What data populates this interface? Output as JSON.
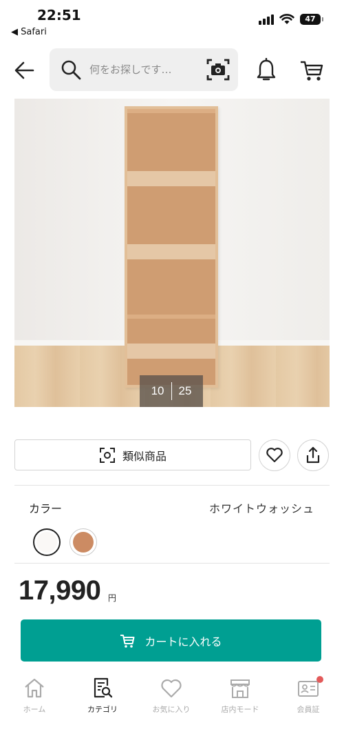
{
  "status_bar": {
    "time": "22:51",
    "back_app": "◀ Safari",
    "battery": "47"
  },
  "header": {
    "search_placeholder": "何をお探しです…"
  },
  "gallery": {
    "current": "10",
    "total": "25"
  },
  "actions": {
    "similar_label": "類似商品"
  },
  "color": {
    "label": "カラー",
    "selected": "ホワイトウォッシュ",
    "options": [
      {
        "name": "white-wash",
        "hex": "#faf8f6"
      },
      {
        "name": "brown",
        "hex": "#cc8b63"
      }
    ]
  },
  "price": {
    "amount": "17,990",
    "currency": "円"
  },
  "cart_button": {
    "label": "カートに入れる",
    "color": "#009f92"
  },
  "bottom_nav": {
    "items": [
      {
        "label": "ホーム",
        "icon": "home-icon"
      },
      {
        "label": "カテゴリ",
        "icon": "category-search-icon",
        "active": true
      },
      {
        "label": "お気に入り",
        "icon": "heart-icon"
      },
      {
        "label": "店内モード",
        "icon": "store-icon"
      },
      {
        "label": "会員証",
        "icon": "member-card-icon",
        "badge": true
      }
    ]
  }
}
